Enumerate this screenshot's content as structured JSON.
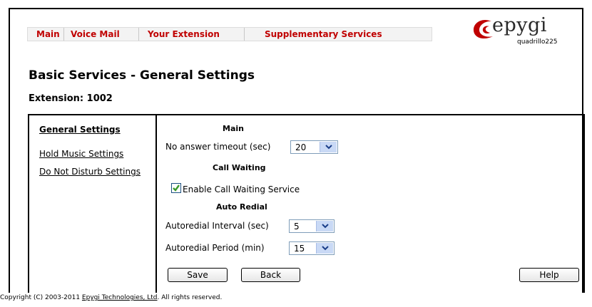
{
  "nav": {
    "items": [
      {
        "label": "Main"
      },
      {
        "label": "Voice Mail"
      },
      {
        "label": "Your Extension"
      },
      {
        "label": "Supplementary Services"
      }
    ]
  },
  "logo": {
    "brand": "epygi",
    "model": "quadrillo225"
  },
  "page": {
    "title": "Basic Services - General Settings",
    "extension_label": "Extension: 1002"
  },
  "sidebar": {
    "items": [
      {
        "label": "General Settings"
      },
      {
        "label": "Hold Music Settings"
      },
      {
        "label": "Do Not Disturb Settings"
      }
    ]
  },
  "sections": {
    "main": {
      "title": "Main",
      "no_answer_label": "No answer timeout (sec)",
      "no_answer_value": "20"
    },
    "call_waiting": {
      "title": "Call Waiting",
      "enable_label": "Enable Call Waiting Service",
      "enabled": true
    },
    "auto_redial": {
      "title": "Auto Redial",
      "interval_label": "Autoredial Interval (sec)",
      "interval_value": "5",
      "period_label": "Autoredial Period (min)",
      "period_value": "15"
    }
  },
  "buttons": {
    "save": "Save",
    "back": "Back",
    "help": "Help"
  },
  "footer": {
    "prefix": "Copyright (C) 2003-2011 ",
    "company": "Epygi Technologies, Ltd",
    "suffix": ". All rights reserved."
  },
  "colors": {
    "nav_link": "#c00000",
    "logo_accent": "#c00000",
    "check": "#3a9a2a",
    "select_arrow_bg": "#c9d9f5"
  }
}
